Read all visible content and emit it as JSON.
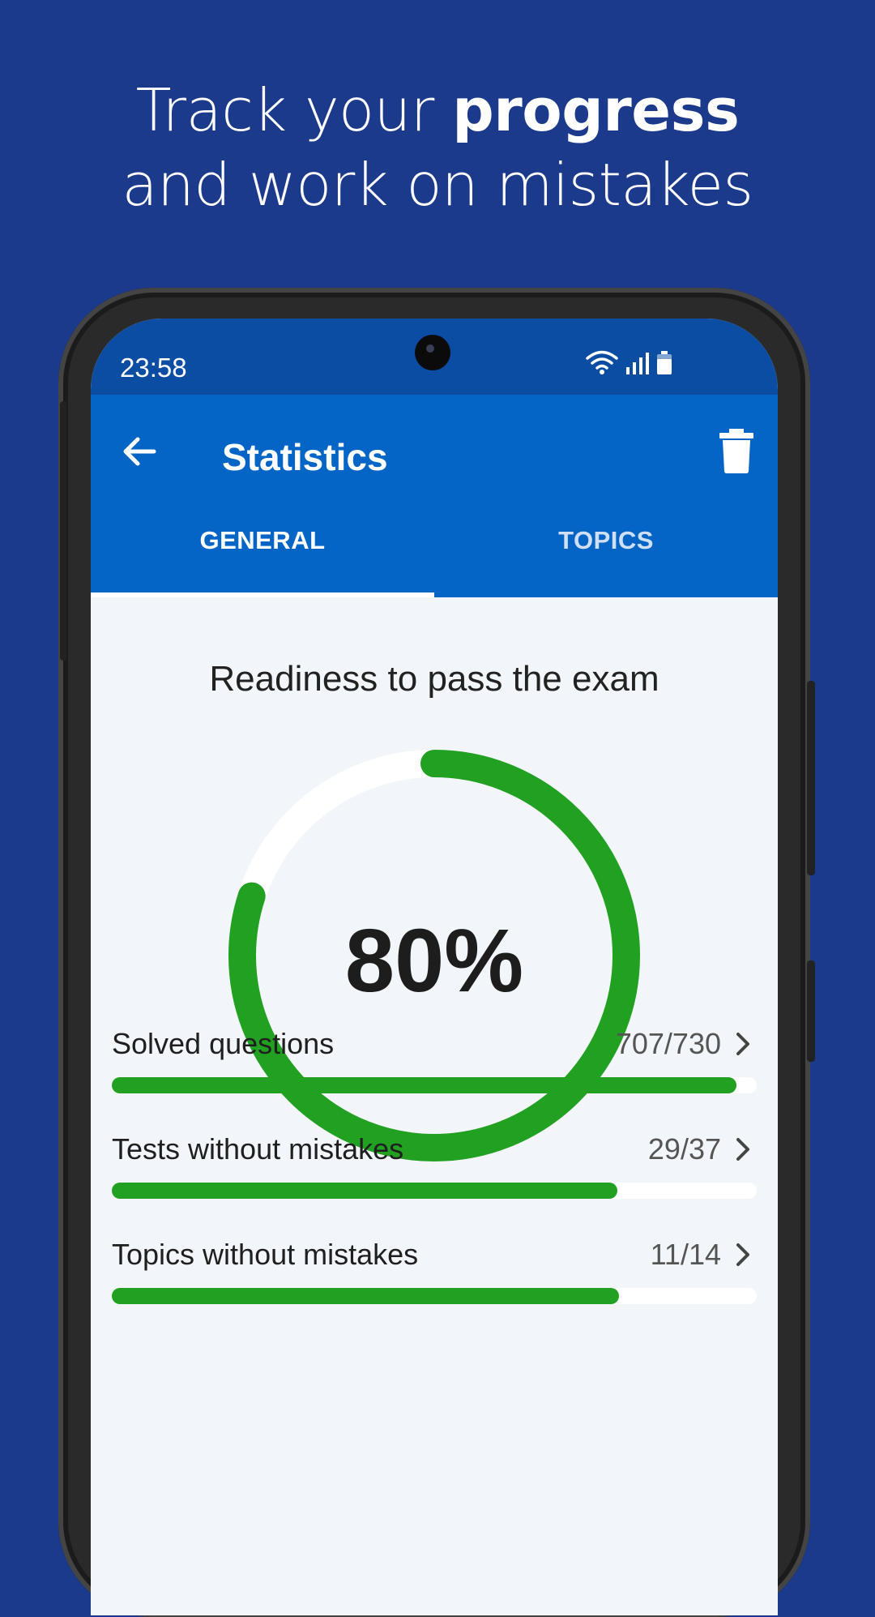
{
  "promo": {
    "line1_prefix": "Track your ",
    "line1_bold": "progress",
    "line2": "and work on mistakes"
  },
  "status_bar": {
    "time": "23:58",
    "icons": [
      "wifi-icon",
      "signal-icon",
      "battery-icon"
    ]
  },
  "app_bar": {
    "title": "Statistics",
    "back_icon": "arrow-left-icon",
    "delete_icon": "trash-icon"
  },
  "tabs": [
    {
      "label": "GENERAL",
      "selected": true
    },
    {
      "label": "TOPICS",
      "selected": false
    }
  ],
  "readiness": {
    "title": "Readiness to pass the exam",
    "percent_label": "80%",
    "value": 0.8
  },
  "stats": [
    {
      "label": "Solved questions",
      "value": "707/730",
      "progress": 0.968
    },
    {
      "label": "Tests without mistakes",
      "value": "29/37",
      "progress": 0.784
    },
    {
      "label": "Topics without mistakes",
      "value": "11/14",
      "progress": 0.786
    }
  ],
  "colors": {
    "background": "#1b3a8c",
    "app_bar": "#0565c6",
    "status_bar": "#0a4da3",
    "progress_green": "#21a021",
    "ring_track": "#ffffff"
  }
}
